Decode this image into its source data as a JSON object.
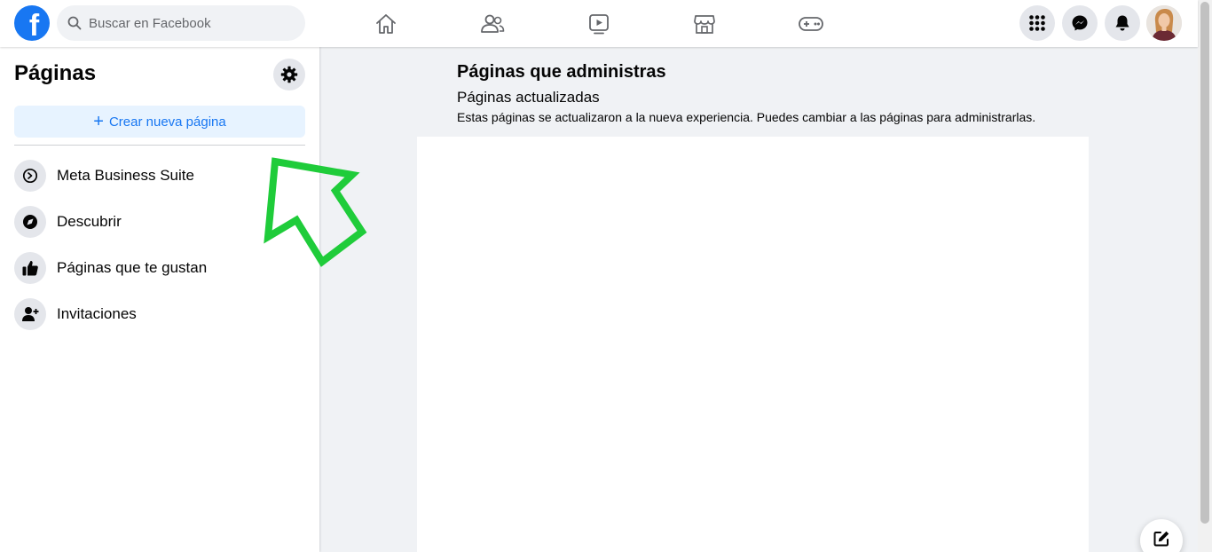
{
  "header": {
    "logo_letter": "f",
    "search_placeholder": "Buscar en Facebook",
    "nav_icons": [
      "home-icon",
      "friends-icon",
      "watch-icon",
      "marketplace-icon",
      "gaming-icon"
    ],
    "right_icons": [
      "menu-grid-icon",
      "messenger-icon",
      "notifications-bell-icon",
      "profile-avatar"
    ]
  },
  "sidebar": {
    "title": "Páginas",
    "create_label": "Crear nueva página",
    "items": [
      {
        "label": "Meta Business Suite",
        "icon": "meta-business-suite-icon"
      },
      {
        "label": "Descubrir",
        "icon": "compass-icon"
      },
      {
        "label": "Páginas que te gustan",
        "icon": "thumbs-up-icon"
      },
      {
        "label": "Invitaciones",
        "icon": "person-add-icon"
      }
    ]
  },
  "main": {
    "title": "Páginas que administras",
    "subtitle": "Páginas actualizadas",
    "description": "Estas páginas se actualizaron a la nueva experiencia. Puedes cambiar a las páginas para administrarlas."
  },
  "colors": {
    "brand_blue": "#1877f2",
    "page_bg": "#f0f2f5",
    "annotation_green": "#1fcc3a"
  }
}
